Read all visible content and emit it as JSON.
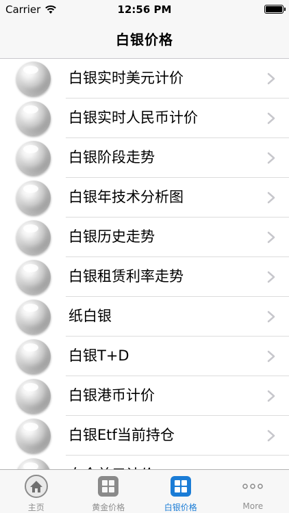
{
  "status_bar": {
    "carrier": "Carrier",
    "time": "12:56 PM"
  },
  "nav": {
    "title": "白银价格"
  },
  "list": {
    "items": [
      {
        "label": "白银实时美元计价"
      },
      {
        "label": "白银实时人民币计价"
      },
      {
        "label": "白银阶段走势"
      },
      {
        "label": "白银年技术分析图"
      },
      {
        "label": "白银历史走势"
      },
      {
        "label": "白银租赁利率走势"
      },
      {
        "label": "纸白银"
      },
      {
        "label": "白银T+D"
      },
      {
        "label": "白银港币计价"
      },
      {
        "label": "白银Etf当前持仓"
      },
      {
        "label": "白金美元计价"
      }
    ]
  },
  "tab_bar": {
    "tabs": [
      {
        "label": "主页",
        "icon": "home-icon"
      },
      {
        "label": "黄金价格",
        "icon": "grid-icon"
      },
      {
        "label": "白银价格",
        "icon": "grid-icon"
      },
      {
        "label": "More",
        "icon": "more-dots-icon"
      }
    ],
    "active_index": 2
  },
  "colors": {
    "accent": "#1a7cd6",
    "inactive": "#8e8e8e",
    "separator": "#dcdcdc"
  }
}
